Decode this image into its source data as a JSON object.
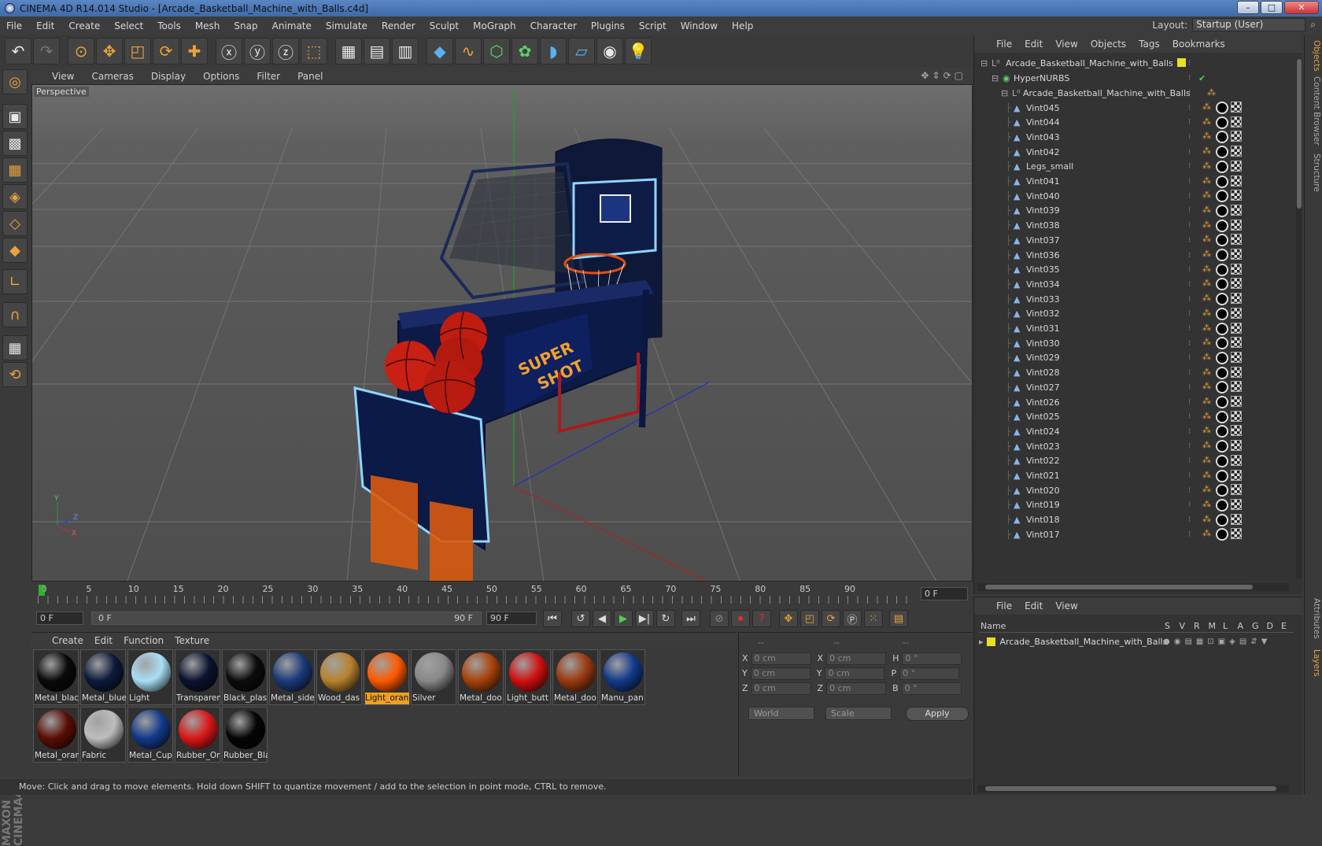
{
  "window": {
    "title": "CINEMA 4D R14.014 Studio - [Arcade_Basketball_Machine_with_Balls.c4d]"
  },
  "menu": [
    "File",
    "Edit",
    "Create",
    "Select",
    "Tools",
    "Mesh",
    "Snap",
    "Animate",
    "Simulate",
    "Render",
    "Sculpt",
    "MoGraph",
    "Character",
    "Plugins",
    "Script",
    "Window",
    "Help"
  ],
  "layout": {
    "label": "Layout:",
    "value": "Startup (User)"
  },
  "viewport": {
    "menu": [
      "View",
      "Cameras",
      "Display",
      "Options",
      "Filter",
      "Panel"
    ],
    "label": "Perspective",
    "scene": {
      "sign_text_1": "SUPER",
      "sign_text_2": "SHOT"
    }
  },
  "timeline": {
    "ticks": [
      "0",
      "5",
      "10",
      "15",
      "20",
      "25",
      "30",
      "35",
      "40",
      "45",
      "50",
      "55",
      "60",
      "65",
      "70",
      "75",
      "80",
      "85",
      "90"
    ],
    "current_frame": "0 F",
    "start": "0 F",
    "range_start": "0 F",
    "range_end": "90 F",
    "end": "90 F"
  },
  "materials": {
    "menu": [
      "Create",
      "Edit",
      "Function",
      "Texture"
    ],
    "items": [
      {
        "name": "Metal_blac",
        "color": "#0a0a0a"
      },
      {
        "name": "Metal_blue",
        "color": "#0d1a3a"
      },
      {
        "name": "Light",
        "color": "#a8dff5"
      },
      {
        "name": "Transparen",
        "color": "#0b1330"
      },
      {
        "name": "Black_plast",
        "color": "#0c0c0c"
      },
      {
        "name": "Metal_side",
        "color": "#1b3a7a"
      },
      {
        "name": "Wood_das",
        "color": "#b8822e"
      },
      {
        "name": "Light_oran",
        "color": "#ff5a00"
      },
      {
        "name": "Silver",
        "color": "#888888"
      },
      {
        "name": "Metal_doo",
        "color": "#a8420a"
      },
      {
        "name": "Light_butt",
        "color": "#d01010"
      },
      {
        "name": "Metal_doo",
        "color": "#9a3a10"
      },
      {
        "name": "Manu_pan",
        "color": "#123a8a"
      },
      {
        "name": "Metal_oran",
        "color": "#5a0e06"
      },
      {
        "name": "Fabric",
        "color": "#bdbdbd"
      },
      {
        "name": "Metal_Cup",
        "color": "#123a8a"
      },
      {
        "name": "Rubber_Or",
        "color": "#d81818"
      },
      {
        "name": "Rubber_Bla",
        "color": "#050505"
      }
    ],
    "selected_index": 7
  },
  "coords": {
    "header": [
      "--",
      "--",
      "--"
    ],
    "rows": [
      {
        "a": "X",
        "v1": "0 cm",
        "b": "X",
        "v2": "0 cm",
        "c": "H",
        "v3": "0 °"
      },
      {
        "a": "Y",
        "v1": "0 cm",
        "b": "Y",
        "v2": "0 cm",
        "c": "P",
        "v3": "0 °"
      },
      {
        "a": "Z",
        "v1": "0 cm",
        "b": "Z",
        "v2": "0 cm",
        "c": "B",
        "v3": "0 °"
      }
    ],
    "mode1": "World",
    "mode2": "Scale",
    "apply": "Apply"
  },
  "status": "Move: Click and drag to move elements. Hold down SHIFT to quantize movement / add to the selection in point mode, CTRL to remove.",
  "objects": {
    "menu": [
      "File",
      "Edit",
      "View",
      "Objects",
      "Tags",
      "Bookmarks"
    ],
    "root": "Arcade_Basketball_Machine_with_Balls",
    "nurbs": "HyperNURBS",
    "group": "Arcade_Basketball_Machine_with_Balls",
    "children": [
      "Vint045",
      "Vint044",
      "Vint043",
      "Vint042",
      "Legs_small",
      "Vint041",
      "Vint040",
      "Vint039",
      "Vint038",
      "Vint037",
      "Vint036",
      "Vint035",
      "Vint034",
      "Vint033",
      "Vint032",
      "Vint031",
      "Vint030",
      "Vint029",
      "Vint028",
      "Vint027",
      "Vint026",
      "Vint025",
      "Vint024",
      "Vint023",
      "Vint022",
      "Vint021",
      "Vint020",
      "Vint019",
      "Vint018",
      "Vint017"
    ]
  },
  "layers": {
    "menu": [
      "File",
      "Edit",
      "View"
    ],
    "columns": [
      "Name",
      "S",
      "V",
      "R",
      "M",
      "L",
      "A",
      "G",
      "D",
      "E"
    ],
    "row": "Arcade_Basketball_Machine_with_Balls"
  },
  "sidetabs": [
    "Objects",
    "Content Browser",
    "Structure",
    "Attributes",
    "Layers"
  ]
}
